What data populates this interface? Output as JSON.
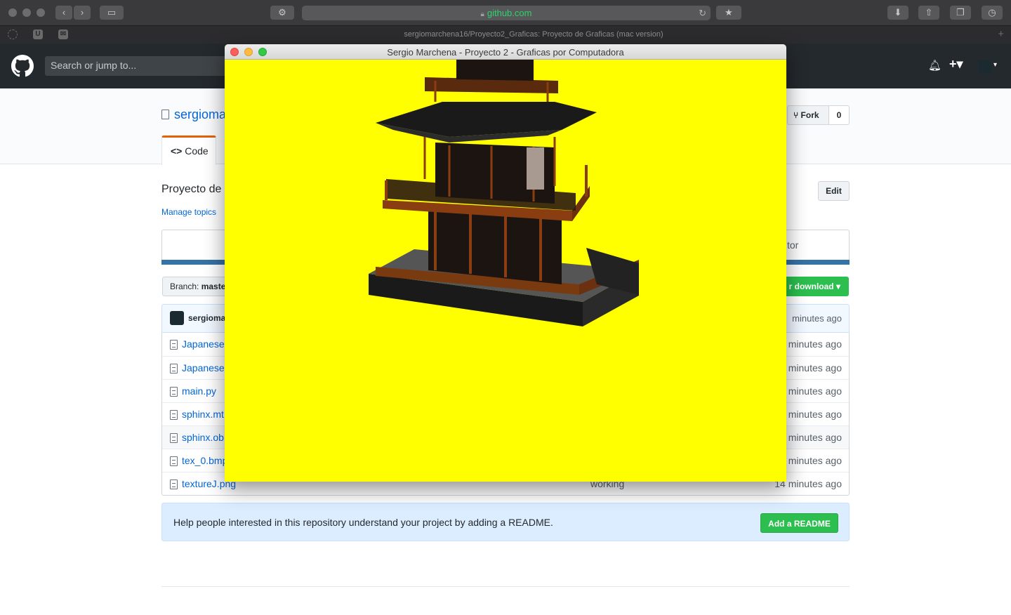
{
  "browser": {
    "url": "github.com",
    "tab_title": "sergiomarchena16/Proyecto2_Graficas: Proyecto de Graficas (mac version)"
  },
  "github": {
    "search_placeholder": "Search or jump to...",
    "repo_name_partial": "sergioma",
    "code_tab_label": "Code",
    "fork_label": "Fork",
    "fork_count": "0",
    "description_partial": "Proyecto de",
    "edit_label": "Edit",
    "manage_topics": "Manage topics",
    "contributor_partial": "tor",
    "branch_label": "Branch:",
    "branch_value_partial": "maste",
    "clone_label_partial": "r download",
    "commit_author_partial": "sergioma",
    "commit_age_partial": "minutes ago",
    "files": [
      {
        "name": "Japanese",
        "message": "",
        "age": "minutes ago"
      },
      {
        "name": "Japanese",
        "message": "",
        "age": "minutes ago"
      },
      {
        "name": "main.py",
        "message": "",
        "age": "minutes ago"
      },
      {
        "name": "sphinx.mt",
        "message": "",
        "age": "minutes ago"
      },
      {
        "name": "sphinx.ob",
        "message": "",
        "age": "minutes ago"
      },
      {
        "name": "tex_0.bmp",
        "message": "",
        "age": "minutes ago"
      },
      {
        "name": "textureJ.png",
        "message": "working",
        "age": "14 minutes ago"
      }
    ],
    "readme_text": "Help people interested in this repository understand your project by adding a README.",
    "readme_button": "Add a README"
  },
  "app_window": {
    "title": "Sergio Marchena - Proyecto 2 - Graficas por Computadora",
    "background": "#ffff00",
    "render_subject": "3D pagoda model"
  },
  "colors": {
    "gh_header": "#24292e",
    "link": "#0366d6",
    "green_button": "#2cbe4e"
  }
}
